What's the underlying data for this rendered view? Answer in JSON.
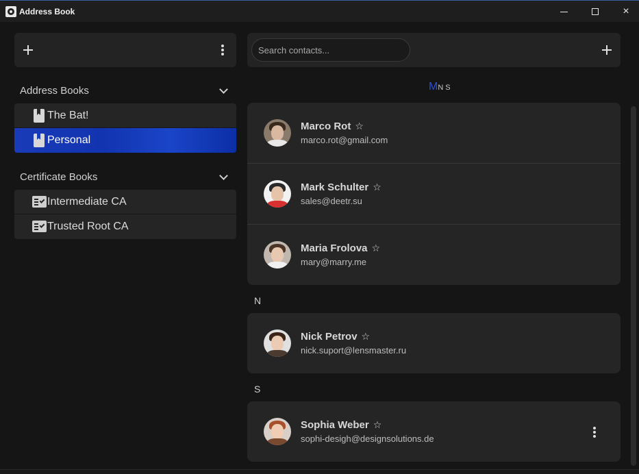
{
  "window": {
    "title": "Address Book",
    "app_icon": "address-book-app-icon",
    "controls": {
      "minimize": "minimize-icon",
      "maximize": "maximize-icon",
      "close": "×"
    }
  },
  "left_panel": {
    "toolbar": {
      "add_icon": "plus-icon",
      "menu_icon": "kebab-menu-icon"
    },
    "address_books": {
      "title": "Address Books",
      "items": [
        {
          "label": "The Bat!",
          "icon": "address-book-icon",
          "selected": false
        },
        {
          "label": "Personal",
          "icon": "address-book-icon",
          "selected": true
        }
      ]
    },
    "certificate_books": {
      "title": "Certificate Books",
      "items": [
        {
          "label": "Intermediate CA",
          "icon": "certificate-icon"
        },
        {
          "label": "Trusted Root CA",
          "icon": "certificate-icon"
        }
      ]
    }
  },
  "right_panel": {
    "search": {
      "placeholder": "Search contacts...",
      "value": ""
    },
    "add_icon": "plus-icon",
    "alphabet_index": {
      "active": "M",
      "letters": [
        "N",
        "S"
      ]
    },
    "groups": [
      {
        "letter": "",
        "contacts": [
          {
            "name": "Marco Rot",
            "email": "marco.rot@gmail.com",
            "favorite_icon": "☆"
          },
          {
            "name": "Mark Schulter",
            "email": "sales@deetr.su",
            "favorite_icon": "☆"
          },
          {
            "name": "Maria Frolova",
            "email": "mary@marry.me",
            "favorite_icon": "☆"
          }
        ]
      },
      {
        "letter": "N",
        "contacts": [
          {
            "name": "Nick Petrov",
            "email": "nick.suport@lensmaster.ru",
            "favorite_icon": "☆"
          }
        ]
      },
      {
        "letter": "S",
        "contacts": [
          {
            "name": "Sophia Weber",
            "email": "sophi-desigh@designsolutions.de",
            "favorite_icon": "☆",
            "has_menu": true
          }
        ]
      }
    ]
  },
  "colors": {
    "background": "#151515",
    "panel": "#232323",
    "card": "#252525",
    "selection": "#1a3bb8",
    "accent_index": "#2a4fe0"
  }
}
